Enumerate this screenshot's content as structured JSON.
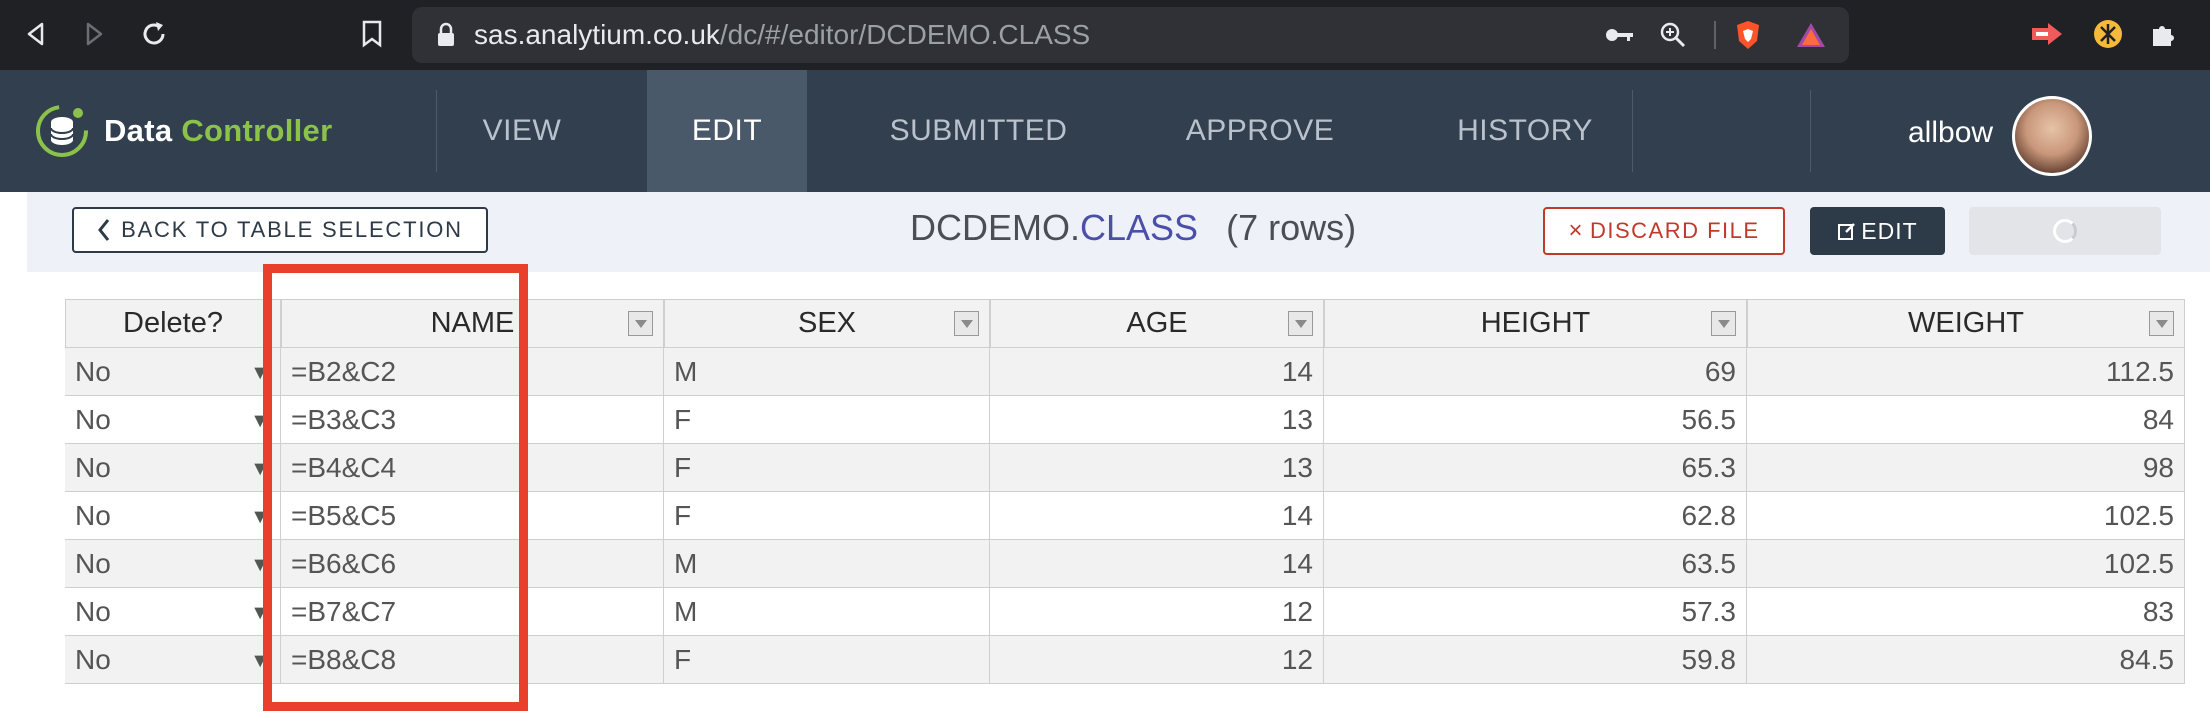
{
  "browser": {
    "url_host": "sas.analytium.co.uk",
    "url_path": "/dc/#/editor/DCDEMO.CLASS"
  },
  "app": {
    "brand_word1": "Data",
    "brand_word2": "Controller",
    "nav": [
      "VIEW",
      "EDIT",
      "SUBMITTED",
      "APPROVE",
      "HISTORY"
    ],
    "active_nav": "EDIT",
    "user": "allbow"
  },
  "toolbar": {
    "back_label": "BACK TO TABLE SELECTION",
    "lib": "DCDEMO.",
    "table": "CLASS",
    "row_count": "(7 rows)",
    "discard_label": "DISCARD FILE",
    "edit_label": "EDIT"
  },
  "grid": {
    "columns": [
      "Delete?",
      "NAME",
      "SEX",
      "AGE",
      "HEIGHT",
      "WEIGHT"
    ],
    "rows": [
      {
        "delete": "No",
        "name": "=B2&C2",
        "sex": "M",
        "age": "14",
        "height": "69",
        "weight": "112.5"
      },
      {
        "delete": "No",
        "name": "=B3&C3",
        "sex": "F",
        "age": "13",
        "height": "56.5",
        "weight": "84"
      },
      {
        "delete": "No",
        "name": "=B4&C4",
        "sex": "F",
        "age": "13",
        "height": "65.3",
        "weight": "98"
      },
      {
        "delete": "No",
        "name": "=B5&C5",
        "sex": "F",
        "age": "14",
        "height": "62.8",
        "weight": "102.5"
      },
      {
        "delete": "No",
        "name": "=B6&C6",
        "sex": "M",
        "age": "14",
        "height": "63.5",
        "weight": "102.5"
      },
      {
        "delete": "No",
        "name": "=B7&C7",
        "sex": "M",
        "age": "12",
        "height": "57.3",
        "weight": "83"
      },
      {
        "delete": "No",
        "name": "=B8&C8",
        "sex": "F",
        "age": "12",
        "height": "59.8",
        "weight": "84.5"
      }
    ]
  },
  "colors": {
    "header_bg": "#323f4e",
    "brand_accent": "#8bc34a",
    "discard_red": "#c0392b",
    "highlight_red": "#e8402a",
    "table_name_color": "#4b4fa8"
  }
}
